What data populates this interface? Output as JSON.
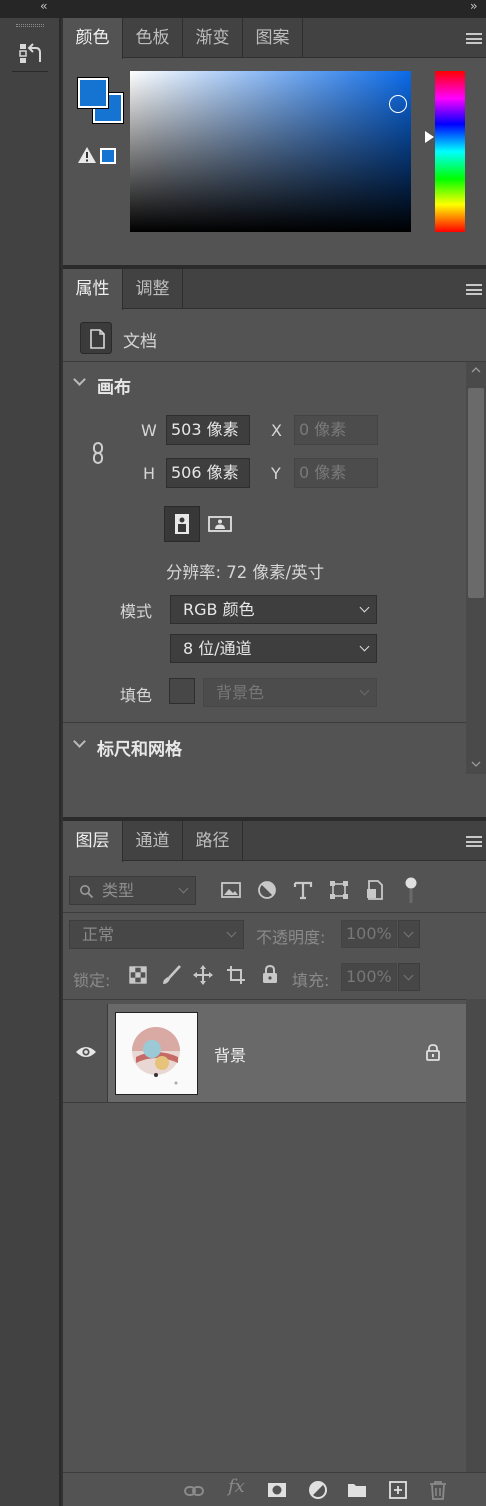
{
  "colors": {
    "foreground": "#1574d1",
    "background": "#1574d1",
    "panel_bg": "#535353",
    "tab_bg": "#424242",
    "field_bg": "#3e3e3e"
  },
  "top_strip": {
    "collapse_left": "‹‹",
    "collapse_right": "››"
  },
  "dock": {
    "tool_icon": "history-icon"
  },
  "color_panel": {
    "tabs": [
      "颜色",
      "色板",
      "渐变",
      "图案"
    ],
    "active_tab": "颜色",
    "icons": [
      "foreground-swatch",
      "background-swatch",
      "gamut-warning-icon",
      "web-safe-swatch",
      "saturation-brightness-field",
      "hue-slider"
    ]
  },
  "properties_panel": {
    "tabs": [
      "属性",
      "调整"
    ],
    "active_tab": "属性",
    "doc_label": "文档",
    "canvas_section": "画布",
    "w_label": "W",
    "w_value": "503 像素",
    "h_label": "H",
    "h_value": "506 像素",
    "x_label": "X",
    "x_placeholder": "0 像素",
    "y_label": "Y",
    "y_placeholder": "0 像素",
    "resolution": "分辨率: 72 像素/英寸",
    "mode_label": "模式",
    "mode_value": "RGB 颜色",
    "bit_depth_value": "8 位/通道",
    "fill_label": "填色",
    "fill_value": "背景色",
    "rulers_section": "标尺和网格"
  },
  "layers_panel": {
    "tabs": [
      "图层",
      "通道",
      "路径"
    ],
    "active_tab": "图层",
    "filter_placeholder": "类型",
    "filter_icons": [
      "image-filter-icon",
      "adjustment-filter-icon",
      "type-filter-icon",
      "shape-filter-icon",
      "smart-object-filter-icon",
      "filter-toggle-icon"
    ],
    "blend_mode": "正常",
    "opacity_label": "不透明度:",
    "opacity_value": "100%",
    "lock_label": "锁定:",
    "lock_icons": [
      "lock-transparent-icon",
      "lock-image-icon",
      "lock-position-icon",
      "lock-artboard-icon",
      "lock-all-icon"
    ],
    "fill_label": "填充:",
    "fill_value": "100%",
    "layers": [
      {
        "name": "背景",
        "visible": true,
        "locked": true
      }
    ],
    "footer_icons": [
      "link-layers-icon",
      "fx-icon",
      "layer-mask-icon",
      "adjustment-layer-icon",
      "new-group-icon",
      "new-layer-icon",
      "trash-icon"
    ],
    "fx_label": "fx"
  }
}
